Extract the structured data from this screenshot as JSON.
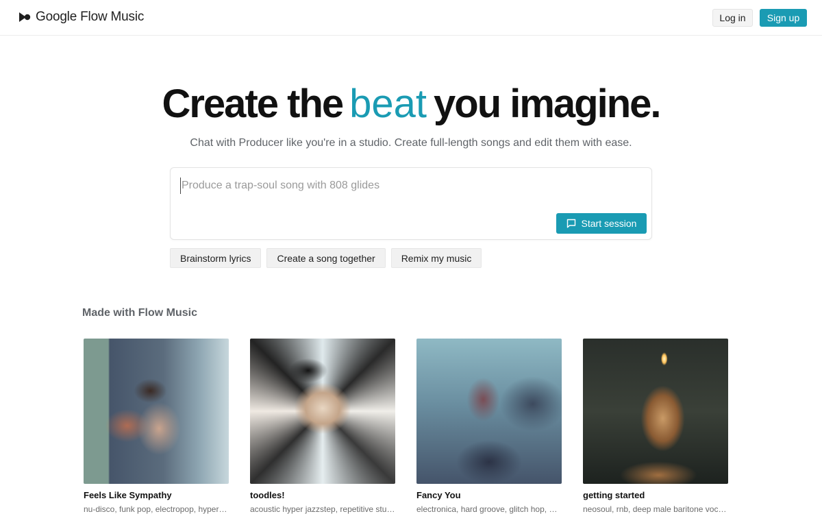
{
  "header": {
    "brand": "Google Flow Music",
    "login_label": "Log in",
    "signup_label": "Sign up"
  },
  "hero": {
    "title_before": "Create the",
    "title_accent": "beat",
    "title_after": "you imagine.",
    "subtitle": "Chat with Producer like you're in a studio. Create full-length songs and edit them with ease."
  },
  "prompt": {
    "placeholder": "Produce a trap-soul song with 808 glides",
    "value": "",
    "start_label": "Start session"
  },
  "chips": [
    {
      "label": "Brainstorm lyrics"
    },
    {
      "label": "Create a song together"
    },
    {
      "label": "Remix my music"
    }
  ],
  "gallery": {
    "title": "Made with Flow Music",
    "cards": [
      {
        "title": "Feels Like Sympathy",
        "tags": "nu-disco, funk pop, electropop, hyperpop, slick female vocals"
      },
      {
        "title": "toodles!",
        "tags": "acoustic hyper jazzstep, repetitive stutter vocals"
      },
      {
        "title": "Fancy You",
        "tags": "electronica, hard groove, glitch hop, electro"
      },
      {
        "title": "getting started",
        "tags": "neosoul, rnb, deep male baritone vocal, warm keys"
      }
    ]
  },
  "colors": {
    "accent": "#1a9bb3",
    "text": "#111111",
    "muted": "#5f6368"
  }
}
